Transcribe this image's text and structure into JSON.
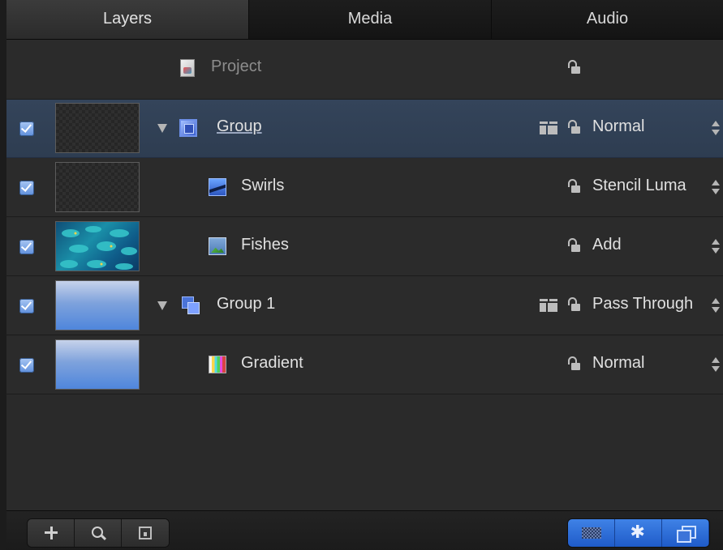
{
  "tabs": [
    {
      "label": "Layers",
      "active": true
    },
    {
      "label": "Media",
      "active": false
    },
    {
      "label": "Audio",
      "active": false
    }
  ],
  "project": {
    "label": "Project"
  },
  "layers": [
    {
      "name": "Group",
      "blend": "Normal",
      "selected": true,
      "icon": "group-icon",
      "thumbnail": "checker"
    },
    {
      "name": "Swirls",
      "blend": "Stencil Luma",
      "selected": false,
      "icon": "shape-icon",
      "thumbnail": "checker"
    },
    {
      "name": "Fishes",
      "blend": "Add",
      "selected": false,
      "icon": "image-icon",
      "thumbnail": "fish"
    },
    {
      "name": "Group 1",
      "blend": "Pass Through",
      "selected": false,
      "icon": "group-icon",
      "thumbnail": "blue-gradient"
    },
    {
      "name": "Gradient",
      "blend": "Normal",
      "selected": false,
      "icon": "gradient-icon",
      "thumbnail": "blue-gradient"
    }
  ],
  "toolbar": {
    "left": [
      "add-icon",
      "search-icon",
      "isolate-icon"
    ],
    "right": [
      "checkerboard-icon",
      "gear-icon",
      "layers-icon"
    ]
  },
  "colors": {
    "selection": "#34445a",
    "accent": "#2f6fd8"
  }
}
